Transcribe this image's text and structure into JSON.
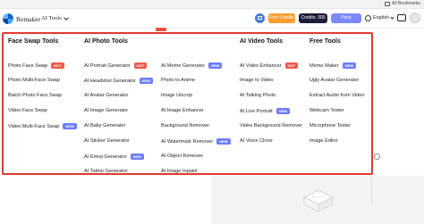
{
  "bookmarks": {
    "all_bookmarks": "All Bookmarks"
  },
  "header": {
    "brand": "Remaker",
    "tools_menu": "AI Tools",
    "free_credits": "Free Credits",
    "credits": "Credits: 300",
    "price": "Price",
    "language": "English"
  },
  "menu": {
    "columns": [
      {
        "title": "Face Swap Tools",
        "items": [
          {
            "label": "Photo Face Swap",
            "badge": "HOT"
          },
          {
            "label": "Photo Multi-Face Swap",
            "badge": ""
          },
          {
            "label": "Batch Photo Face Swap",
            "badge": ""
          },
          {
            "label": "Video Face Swap",
            "badge": ""
          },
          {
            "label": "Video Multi-Face Swap",
            "badge": "NEW"
          }
        ]
      },
      {
        "title": "AI Photo Tools",
        "items": [
          {
            "label": "AI Portrait Generator",
            "badge": "HOT"
          },
          {
            "label": "AI Headshot Generator",
            "badge": "NEW"
          },
          {
            "label": "AI Avatar Generator",
            "badge": ""
          },
          {
            "label": "AI Image Generator",
            "badge": ""
          },
          {
            "label": "AI Baby Generator",
            "badge": ""
          },
          {
            "label": "AI Sticker Generator",
            "badge": ""
          },
          {
            "label": "AI Emoji Generator",
            "badge": "NEW"
          },
          {
            "label": "AI Tattoo Generator",
            "badge": ""
          }
        ]
      },
      {
        "title": "",
        "items": [
          {
            "label": "AI Meme Generator",
            "badge": "NEW"
          },
          {
            "label": "Photo to Anime",
            "badge": ""
          },
          {
            "label": "Image Uncrop",
            "badge": ""
          },
          {
            "label": "AI Image Enhancer",
            "badge": ""
          },
          {
            "label": "Background Remover",
            "badge": ""
          },
          {
            "label": "AI Watermark Remover",
            "badge": "NEW"
          },
          {
            "label": "AI Object Remover",
            "badge": ""
          },
          {
            "label": "AI Image Inpaint",
            "badge": ""
          }
        ]
      },
      {
        "title": "AI Video Tools",
        "items": [
          {
            "label": "AI Video Enhancer",
            "badge": "HOT"
          },
          {
            "label": "Image to Video",
            "badge": ""
          },
          {
            "label": "AI Talking Photo",
            "badge": ""
          },
          {
            "label": "AI Live Portrait",
            "badge": "NEW"
          },
          {
            "label": "Video Background Remover",
            "badge": ""
          },
          {
            "label": "AI Voice Clone",
            "badge": ""
          }
        ]
      },
      {
        "title": "Free Tools",
        "items": [
          {
            "label": "Meme Maker",
            "badge": "NEW"
          },
          {
            "label": "Ugly Avatar Generator",
            "badge": ""
          },
          {
            "label": "Extract Audio from Video",
            "badge": ""
          },
          {
            "label": "Webcam Tester",
            "badge": ""
          },
          {
            "label": "Microphone Tester",
            "badge": ""
          },
          {
            "label": "Image Editor",
            "badge": ""
          }
        ]
      }
    ]
  },
  "colors": {
    "accent_border": "#e03a2e",
    "hot": "#ef5a4a",
    "new": "#6b7cff",
    "free_credits": "#ff9d2e",
    "price": "#7d89ff"
  },
  "icons": [
    "logo-icon",
    "chevron-down-icon",
    "folder-icon",
    "translate-icon",
    "globe-icon",
    "chat-icon",
    "avatar"
  ]
}
